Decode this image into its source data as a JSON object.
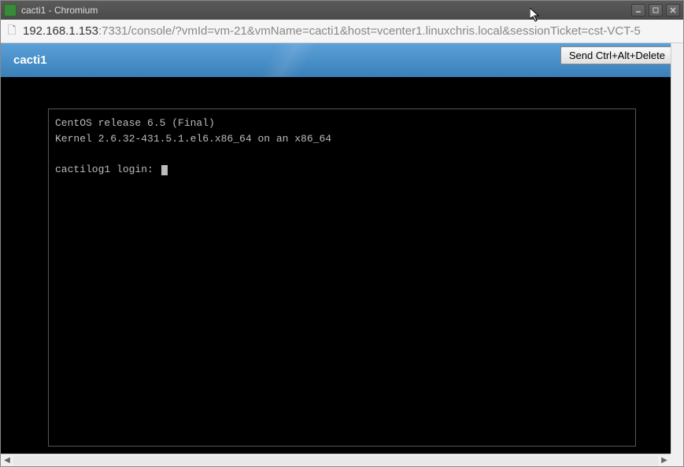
{
  "window": {
    "title": "cacti1 - Chromium"
  },
  "address": {
    "host": "192.168.1.153",
    "port": ":7331",
    "path": "/console/?vmId=vm-21&vmName=cacti1&host=vcenter1.linuxchris.local&sessionTicket=cst-VCT-5"
  },
  "vm": {
    "name": "cacti1",
    "send_cad_label": "Send Ctrl+Alt+Delete"
  },
  "console": {
    "line1": "CentOS release 6.5 (Final)",
    "line2": "Kernel 2.6.32-431.5.1.el6.x86_64 on an x86_64",
    "prompt": "cactilog1 login: "
  }
}
